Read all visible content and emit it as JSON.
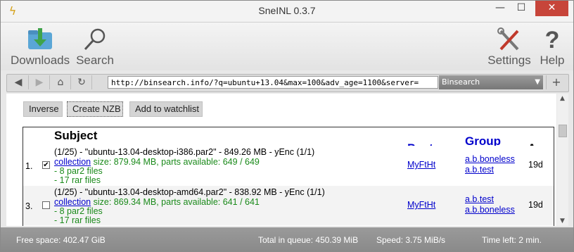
{
  "window": {
    "title": "SneINL 0.3.7"
  },
  "toolbar": {
    "downloads": "Downloads",
    "search": "Search",
    "settings": "Settings",
    "help": "Help"
  },
  "navbar": {
    "url": "http://binsearch.info/?q=ubuntu+13.04&max=100&adv_age=1100&server=",
    "engine": "Binsearch"
  },
  "actions": {
    "inverse": "Inverse",
    "create_nzb": "Create NZB",
    "add_watchlist": "Add to watchlist"
  },
  "table": {
    "headers": {
      "subject": "Subject",
      "poster": "Poster",
      "group": "Group",
      "age": "Age"
    },
    "rows": [
      {
        "index": "1.",
        "checked": true,
        "subject": "(1/25) - \"ubuntu-13.04-desktop-i386.par2\" - 849.26 MB - yEnc (1/1)",
        "collection": "collection",
        "details": "size: 879.94 MB, parts available: 649 / 649",
        "par2": "- 8 par2 files",
        "rar": "- 17 rar files",
        "poster": "MyFtHt",
        "group1": "a.b.boneless",
        "group2": "a.b.test",
        "age": "19d"
      },
      {
        "index": "3.",
        "checked": false,
        "subject": "(1/25) - \"ubuntu-13.04-desktop-amd64.par2\" - 838.92 MB - yEnc (1/1)",
        "collection": "collection",
        "details": "size: 869.34 MB, parts available: 641 / 641",
        "par2": "- 8 par2 files",
        "rar": "- 17 rar files",
        "poster": "MyFtHt",
        "group1": "a.b.test",
        "group2": "a.b.boneless",
        "age": "19d"
      }
    ]
  },
  "status": {
    "free_space": "Free space: 402.47 GiB",
    "total_queue": "Total in queue: 450.39 MiB",
    "speed": "Speed: 3.75 MiB/s",
    "time_left": "Time left:  2 min."
  },
  "colors": {
    "close_button": "#c7453a",
    "link": "#0000cc",
    "green_text": "#1a8a1a",
    "statusbar": "#8f8f8f"
  }
}
